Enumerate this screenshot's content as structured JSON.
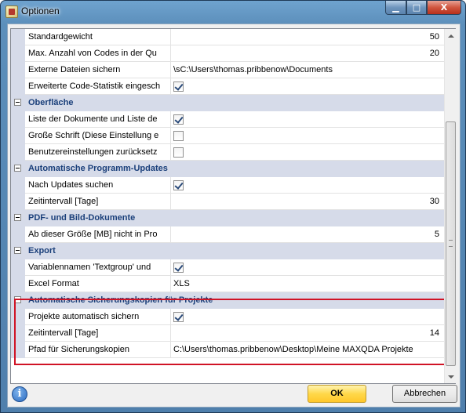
{
  "window": {
    "title": "Optionen",
    "minimize_glyph": "▁",
    "maximize_glyph": "□",
    "close_glyph": "X"
  },
  "grid": {
    "rows": [
      {
        "type": "prop",
        "name": "Standardgewicht",
        "value": "50",
        "kind": "number"
      },
      {
        "type": "prop",
        "name": "Max. Anzahl von Codes in der Qu",
        "value": "20",
        "kind": "number"
      },
      {
        "type": "prop",
        "name": "Externe Dateien sichern",
        "value": "\\sC:\\Users\\thomas.pribbenow\\Documents",
        "kind": "text"
      },
      {
        "type": "prop",
        "name": "Erweiterte Code-Statistik eingesch",
        "checked": true,
        "kind": "check"
      },
      {
        "type": "cat",
        "label": "Oberfläche"
      },
      {
        "type": "prop",
        "name": "Liste der Dokumente und Liste de",
        "checked": true,
        "kind": "check"
      },
      {
        "type": "prop",
        "name": "Große Schrift (Diese Einstellung e",
        "checked": false,
        "kind": "check"
      },
      {
        "type": "prop",
        "name": "Benutzereinstellungen zurücksetz",
        "checked": false,
        "kind": "check"
      },
      {
        "type": "cat",
        "label": "Automatische Programm-Updates"
      },
      {
        "type": "prop",
        "name": "Nach Updates suchen",
        "checked": true,
        "kind": "check"
      },
      {
        "type": "prop",
        "name": "Zeitintervall [Tage]",
        "value": "30",
        "kind": "number"
      },
      {
        "type": "cat",
        "label": "PDF- und Bild-Dokumente"
      },
      {
        "type": "prop",
        "name": "Ab dieser Größe [MB] nicht in Pro",
        "value": "5",
        "kind": "number"
      },
      {
        "type": "cat",
        "label": "Export"
      },
      {
        "type": "prop",
        "name": "Variablennamen 'Textgroup' und",
        "checked": true,
        "kind": "check"
      },
      {
        "type": "prop",
        "name": "Excel Format",
        "value": "XLS",
        "kind": "text"
      },
      {
        "type": "cat",
        "label": "Automatische Sicherungskopien für Projekte"
      },
      {
        "type": "prop",
        "name": "Projekte automatisch sichern",
        "checked": true,
        "kind": "check"
      },
      {
        "type": "prop",
        "name": "Zeitintervall [Tage]",
        "value": "14",
        "kind": "number"
      },
      {
        "type": "prop",
        "name": "Pfad für Sicherungskopien",
        "value": "C:\\Users\\thomas.pribbenow\\Desktop\\Meine MAXQDA Projekte",
        "kind": "text"
      }
    ]
  },
  "footer": {
    "info_glyph": "i",
    "ok_label": "OK",
    "cancel_label": "Abbrechen"
  },
  "colors": {
    "highlight": "#d01325",
    "category_text": "#1a3f7a"
  }
}
